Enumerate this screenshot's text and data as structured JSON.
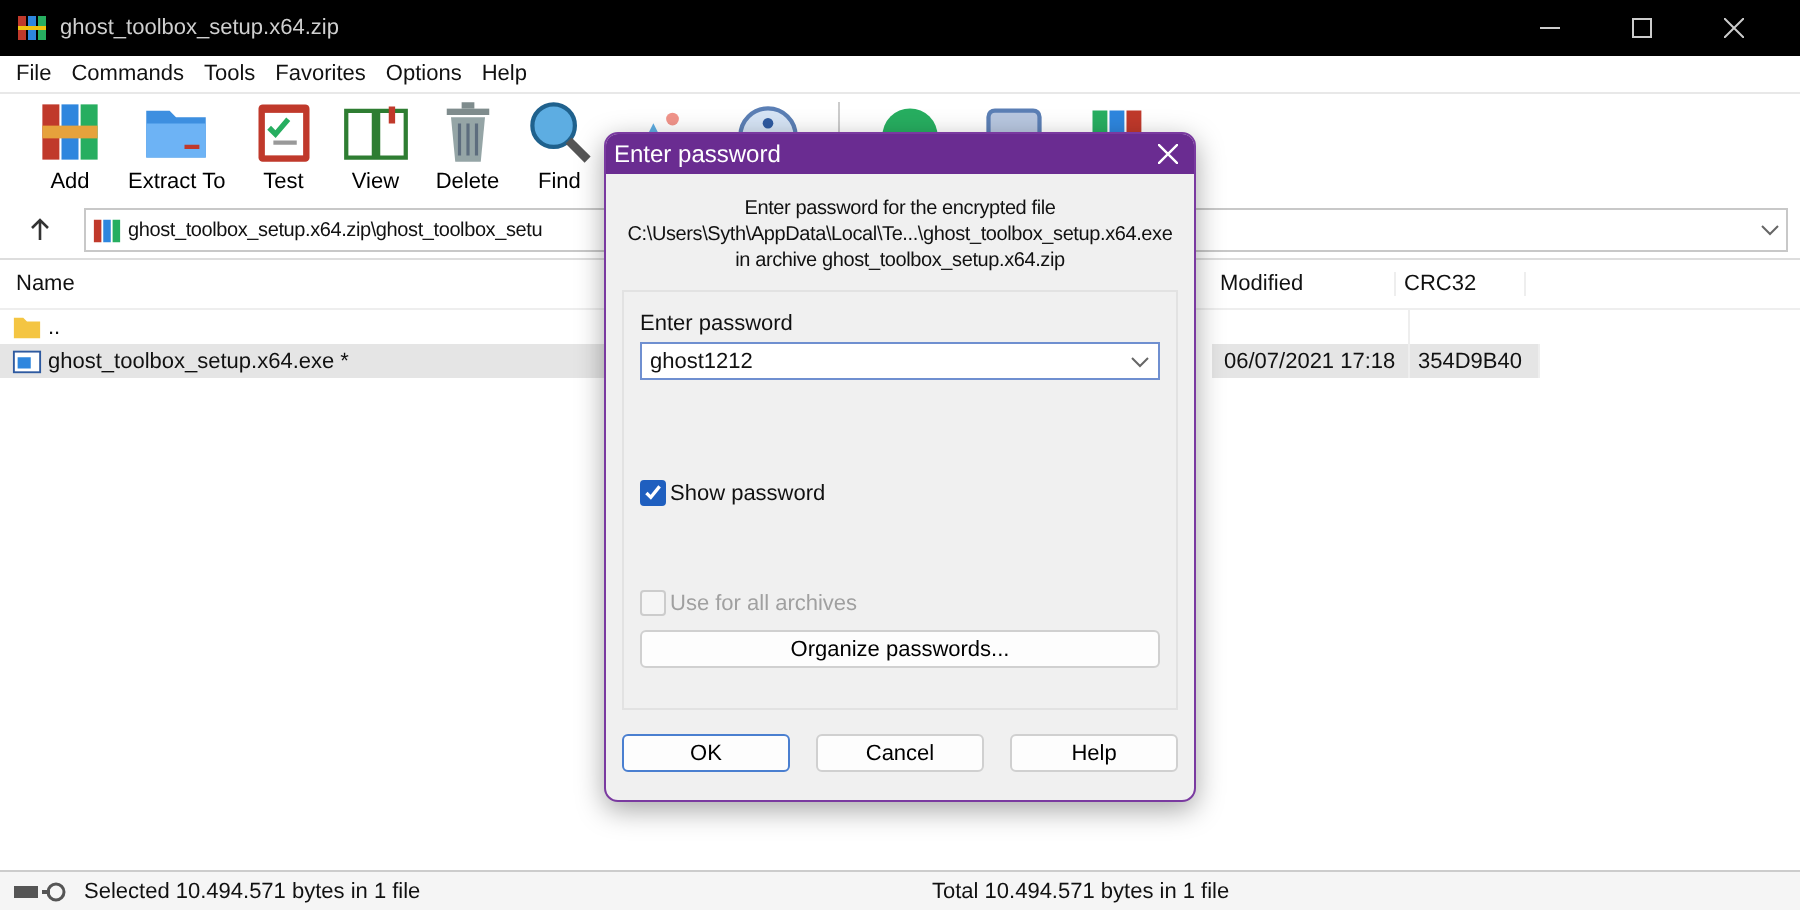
{
  "window": {
    "title": "ghost_toolbox_setup.x64.zip"
  },
  "menu": [
    "File",
    "Commands",
    "Tools",
    "Favorites",
    "Options",
    "Help"
  ],
  "toolbar": [
    {
      "kind": "add",
      "label": "Add"
    },
    {
      "kind": "extract",
      "label": "Extract To"
    },
    {
      "kind": "test",
      "label": "Test"
    },
    {
      "kind": "view",
      "label": "View"
    },
    {
      "kind": "delete",
      "label": "Delete"
    },
    {
      "kind": "find",
      "label": "Find"
    }
  ],
  "address": {
    "value": "ghost_toolbox_setup.x64.zip\\ghost_toolbox_setu"
  },
  "table": {
    "columns": [
      {
        "label": "Name"
      },
      {
        "label": "Modified"
      },
      {
        "label": "CRC32"
      }
    ],
    "rows": [
      {
        "kind": "folder",
        "name": "..",
        "modified": "",
        "crc": "",
        "selected": false
      },
      {
        "kind": "file",
        "name": "ghost_toolbox_setup.x64.exe *",
        "modified": "06/07/2021 17:18",
        "crc": "354D9B40",
        "selected": true
      }
    ]
  },
  "status_bar": {
    "left": "Selected 10.494.571 bytes in 1 file",
    "right": "Total 10.494.571 bytes in 1 file"
  },
  "dialog": {
    "title": "Enter password",
    "message": [
      "Enter password for the encrypted file",
      "C:\\Users\\Syth\\AppData\\Local\\Te...\\ghost_toolbox_setup.x64.exe",
      "in archive ghost_toolbox_setup.x64.zip"
    ],
    "field_label": "Enter password",
    "password": "ghost1212",
    "options": [
      {
        "label": "Show password",
        "checked": true,
        "disabled": false
      },
      {
        "label": "Use for all archives",
        "checked": false,
        "disabled": true
      }
    ],
    "organize": "Organize passwords...",
    "buttons": [
      {
        "label": "OK",
        "default": true
      },
      {
        "label": "Cancel",
        "default": false
      },
      {
        "label": "Help",
        "default": false
      }
    ]
  }
}
